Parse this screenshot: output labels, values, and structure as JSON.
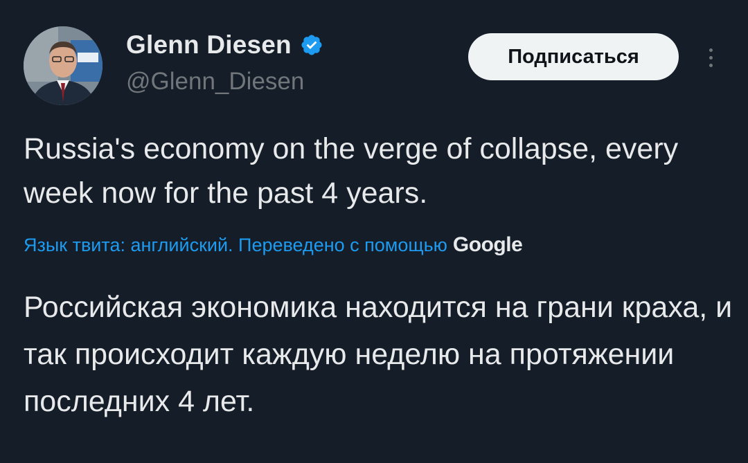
{
  "author": {
    "display_name": "Glenn Diesen",
    "handle": "@Glenn_Diesen",
    "verified": true,
    "verified_icon": "verified-badge-icon",
    "avatar_icon": "profile-photo"
  },
  "actions": {
    "follow_label": "Подписаться",
    "more_icon": "more-vertical-icon"
  },
  "tweet": {
    "text": "Russia's economy on the verge of collapse, every week now for the past 4 years."
  },
  "translation": {
    "meta_label": "Язык твита: английский. Переведено с помощью",
    "provider": "Google",
    "text": "Российская экономика находится на грани краха, и так происходит каждую неделю на протяжении последних 4 лет."
  },
  "colors": {
    "background": "#151d28",
    "text": "#e7e9ea",
    "muted": "#71767b",
    "link": "#1d9bf0",
    "button_bg": "#eff3f4"
  }
}
